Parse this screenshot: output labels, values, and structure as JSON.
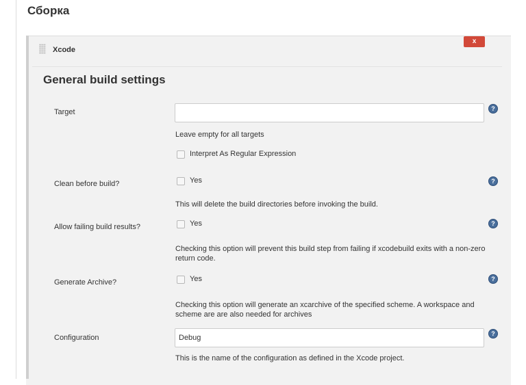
{
  "section": {
    "title": "Сборка"
  },
  "step": {
    "name": "Xcode",
    "delete_label": "x"
  },
  "group": {
    "title": "General build settings"
  },
  "fields": {
    "target": {
      "label": "Target",
      "value": "",
      "description": "Leave empty for all targets",
      "regex_label": "Interpret As Regular Expression",
      "regex_checked": false
    },
    "clean": {
      "label": "Clean before build?",
      "option_label": "Yes",
      "checked": false,
      "description": "This will delete the build directories before invoking the build."
    },
    "allow_failing": {
      "label": "Allow failing build results?",
      "option_label": "Yes",
      "checked": false,
      "description": "Checking this option will prevent this build step from failing if xcodebuild exits with a non-zero return code."
    },
    "archive": {
      "label": "Generate Archive?",
      "option_label": "Yes",
      "checked": false,
      "description": "Checking this option will generate an xcarchive of the specified scheme. A workspace and scheme are are also needed for archives"
    },
    "configuration": {
      "label": "Configuration",
      "value": "Debug",
      "description": "This is the name of the configuration as defined in the Xcode project."
    }
  },
  "help_glyph": "?",
  "icons": {
    "help": "help-icon",
    "drag": "drag-handle-icon"
  },
  "colors": {
    "delete_button": "#d24939",
    "help_icon": "#4a6f9c",
    "panel_bg": "#f2f2f2"
  }
}
